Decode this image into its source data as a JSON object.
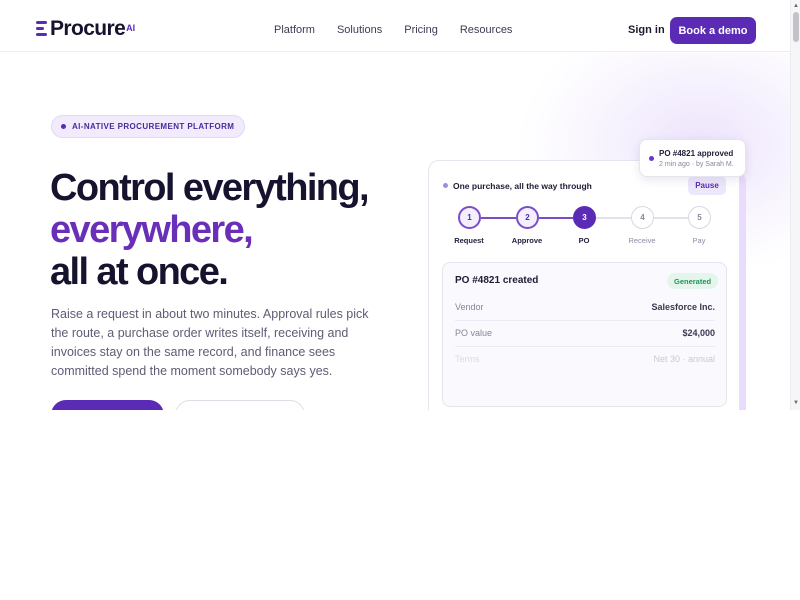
{
  "brand": {
    "name": "Procure",
    "suffix": "AI",
    "accent": "#5b2bb5"
  },
  "nav": {
    "items": [
      {
        "label": "Platform"
      },
      {
        "label": "Solutions"
      },
      {
        "label": "Pricing"
      },
      {
        "label": "Resources"
      }
    ],
    "sign_in": "Sign in",
    "cta": "Book a demo"
  },
  "hero": {
    "badge": "AI-NATIVE PROCUREMENT PLATFORM",
    "headline_line1": "Control everything,",
    "headline_line2": "everywhere,",
    "headline_line3": "all at once.",
    "lead": "Raise a request in about two minutes. Approval rules pick the route, a purchase order writes itself, receiving and invoices stay on the same record, and finance sees committed spend the moment somebody says yes."
  },
  "card": {
    "title": "One purchase, all the way through",
    "pause_label": "Pause",
    "steps": [
      {
        "number": "1",
        "label": "Request",
        "state": "done"
      },
      {
        "number": "2",
        "label": "Approve",
        "state": "done"
      },
      {
        "number": "3",
        "label": "PO",
        "state": "active"
      },
      {
        "number": "4",
        "label": "Receive",
        "state": "todo"
      },
      {
        "number": "5",
        "label": "Pay",
        "state": "todo"
      }
    ],
    "po": {
      "title": "PO #4821 created",
      "status": "Generated",
      "rows": [
        {
          "key": "Vendor",
          "value": "Salesforce Inc."
        },
        {
          "key": "PO value",
          "value": "$24,000"
        },
        {
          "key": "Terms",
          "value": "Net 30 · annual"
        }
      ]
    }
  },
  "toast": {
    "title": "PO #4821 approved",
    "subtitle": "2 min ago · by Sarah M."
  },
  "colors": {
    "primary": "#5b2bb5",
    "headline_accent": "#6a2fb9",
    "success": "#23935a"
  }
}
